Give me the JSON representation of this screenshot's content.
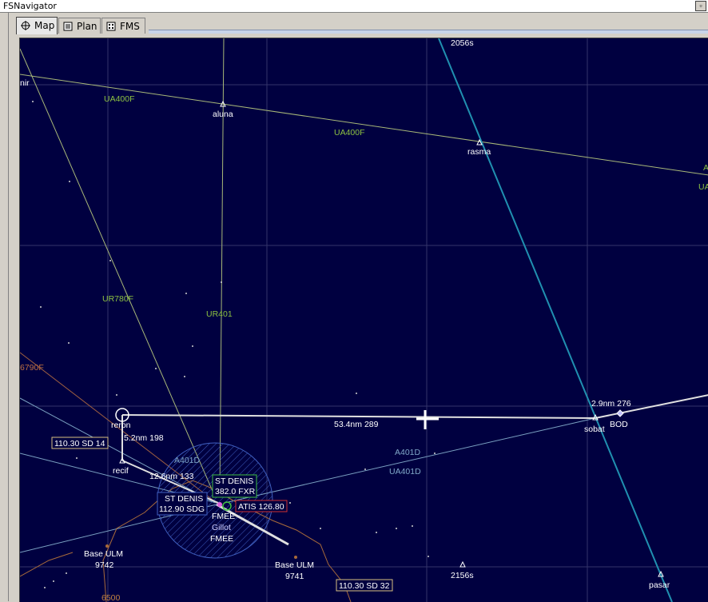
{
  "window": {
    "title": "FSNavigator"
  },
  "tabs": [
    {
      "label": "Map",
      "icon": "crosshair-icon",
      "active": true
    },
    {
      "label": "Plan",
      "icon": "plan-icon",
      "active": false
    },
    {
      "label": "FMS",
      "icon": "fms-icon",
      "active": false
    }
  ],
  "map": {
    "airways": [
      "UA400F",
      "UA400F",
      "UR780F",
      "UR401",
      "A401D",
      "A401D",
      "UA401D",
      "A",
      "UA",
      "6790F",
      "2056s",
      "2156s",
      "6500"
    ],
    "waypoints": [
      "aluna",
      "rasma",
      "reron",
      "recif",
      "sobat",
      "BOD",
      "pasar",
      "nir"
    ],
    "legs": [
      "5.2nm 198",
      "12.6nm 133",
      "53.4nm 289",
      "2.9nm 276"
    ],
    "navaids": {
      "ils1": "110.30 SD 14",
      "ils2": "110.30 SD 32",
      "ndb_name": "ST DENIS",
      "ndb_freq": "382.0 FXR",
      "vor_name": "ST DENIS",
      "vor_freq": "112.90 SDG",
      "atis": "ATIS 126.80",
      "airport1": "FMEE",
      "airport2_name": "Gillot",
      "airport2": "FMEE",
      "base1_name": "Base ULM",
      "base1_elev": "9742",
      "base2_name": "Base ULM",
      "base2_elev": "9741"
    },
    "colors": {
      "background": "#000040",
      "grid": "#3a3a70",
      "airway": "#b8c88a",
      "route": "#d8d8d8",
      "coast": "#b07040"
    }
  }
}
